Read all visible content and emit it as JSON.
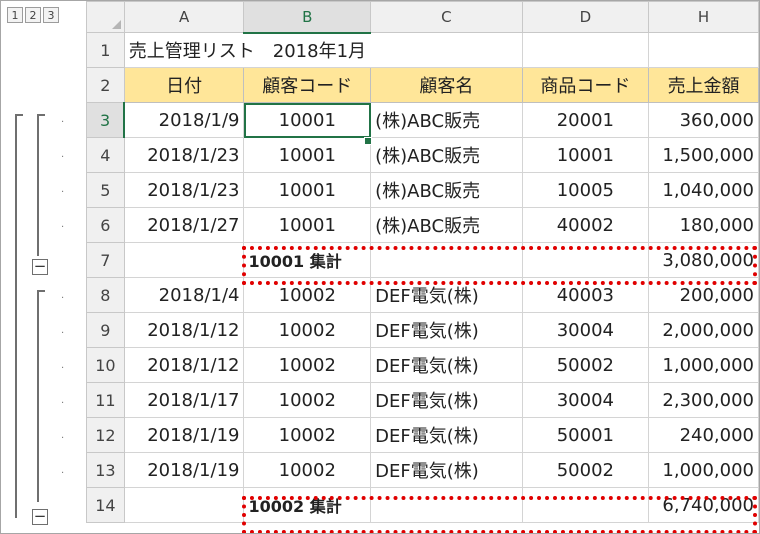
{
  "outline": {
    "levels": [
      "1",
      "2",
      "3"
    ],
    "collapse_symbol": "−"
  },
  "columns": [
    "A",
    "B",
    "C",
    "D",
    "H"
  ],
  "rows": [
    {
      "num": "1",
      "title": "売上管理リスト　2018年1月"
    },
    {
      "num": "2",
      "headers": [
        "日付",
        "顧客コード",
        "顧客名",
        "商品コード",
        "売上金額"
      ]
    },
    {
      "num": "3",
      "date": "2018/1/9",
      "code": "10001",
      "name": "(株)ABC販売",
      "product": "20001",
      "amount": "360,000"
    },
    {
      "num": "4",
      "date": "2018/1/23",
      "code": "10001",
      "name": "(株)ABC販売",
      "product": "10001",
      "amount": "1,500,000"
    },
    {
      "num": "5",
      "date": "2018/1/23",
      "code": "10001",
      "name": "(株)ABC販売",
      "product": "10005",
      "amount": "1,040,000"
    },
    {
      "num": "6",
      "date": "2018/1/27",
      "code": "10001",
      "name": "(株)ABC販売",
      "product": "40002",
      "amount": "180,000"
    },
    {
      "num": "7",
      "subtotal_label": "10001 集計",
      "amount": "3,080,000"
    },
    {
      "num": "8",
      "date": "2018/1/4",
      "code": "10002",
      "name": "DEF電気(株)",
      "product": "40003",
      "amount": "200,000"
    },
    {
      "num": "9",
      "date": "2018/1/12",
      "code": "10002",
      "name": "DEF電気(株)",
      "product": "30004",
      "amount": "2,000,000"
    },
    {
      "num": "10",
      "date": "2018/1/12",
      "code": "10002",
      "name": "DEF電気(株)",
      "product": "50002",
      "amount": "1,000,000"
    },
    {
      "num": "11",
      "date": "2018/1/17",
      "code": "10002",
      "name": "DEF電気(株)",
      "product": "30004",
      "amount": "2,300,000"
    },
    {
      "num": "12",
      "date": "2018/1/19",
      "code": "10002",
      "name": "DEF電気(株)",
      "product": "50001",
      "amount": "240,000"
    },
    {
      "num": "13",
      "date": "2018/1/19",
      "code": "10002",
      "name": "DEF電気(株)",
      "product": "50002",
      "amount": "1,000,000"
    },
    {
      "num": "14",
      "subtotal_label": "10002 集計",
      "amount": "6,740,000"
    }
  ],
  "colors": {
    "header_fill": "#ffe699",
    "selection_green": "#217346",
    "highlight_red": "#e00000"
  }
}
